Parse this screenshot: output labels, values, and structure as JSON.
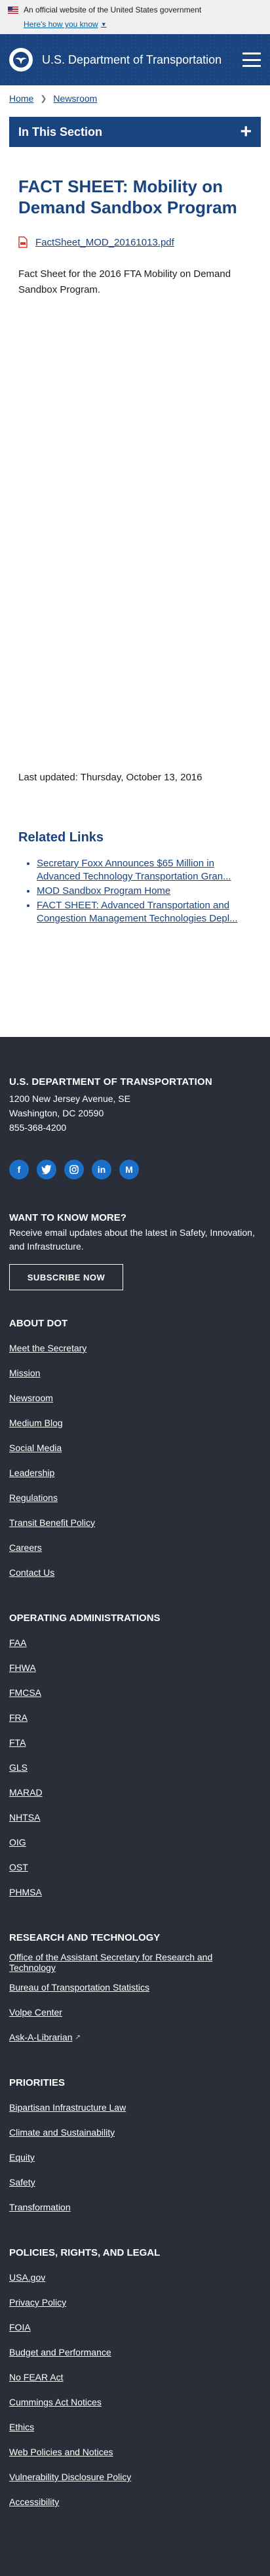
{
  "gov_banner": {
    "text": "An official website of the United States government",
    "link": "Here's how you know"
  },
  "header": {
    "title": "U.S. Department of Transportation"
  },
  "breadcrumb": [
    "Home",
    "Newsroom"
  ],
  "section_bar": {
    "label": "In This Section"
  },
  "page": {
    "title": "FACT SHEET: Mobility on Demand Sandbox Program",
    "file_name": "FactSheet_MOD_20161013.pdf",
    "body": "Fact Sheet for the 2016 FTA Mobility on Demand Sandbox Program.",
    "last_updated": "Last updated: Thursday, October 13, 2016"
  },
  "related": {
    "title": "Related Links",
    "items": [
      "Secretary Foxx Announces $65 Million in Advanced Technology Transportation Gran...",
      "MOD Sandbox Program Home",
      "FACT SHEET: Advanced Transportation and Congestion Management Technologies Depl..."
    ]
  },
  "footer": {
    "org": "U.S. DEPARTMENT OF TRANSPORTATION",
    "address": [
      "1200 New Jersey Avenue, SE",
      "Washington, DC 20590",
      "855-368-4200"
    ],
    "social": [
      "facebook-icon",
      "twitter-icon",
      "instagram-icon",
      "linkedin-icon",
      "medium-icon"
    ],
    "want_title": "WANT TO KNOW MORE?",
    "want_text": "Receive email updates about the latest in Safety, Innovation, and Infrastructure.",
    "subscribe": "SUBSCRIBE NOW",
    "about_title": "ABOUT DOT",
    "about": [
      "Meet the Secretary",
      "Mission",
      "Newsroom",
      "Medium Blog",
      "Social Media",
      "Leadership",
      "Regulations",
      "Transit Benefit Policy",
      "Careers",
      "Contact Us"
    ],
    "ops_title": "OPERATING ADMINISTRATIONS",
    "ops": [
      "FAA",
      "FHWA",
      "FMCSA",
      "FRA",
      "FTA",
      "GLS",
      "MARAD",
      "NHTSA",
      "OIG",
      "OST",
      "PHMSA"
    ],
    "research_title": "RESEARCH AND TECHNOLOGY",
    "research": [
      "Office of the Assistant Secretary for Research and Technology",
      "Bureau of Transportation Statistics",
      "Volpe Center",
      "Ask-A-Librarian"
    ],
    "priorities_title": "PRIORITIES",
    "priorities": [
      "Bipartisan Infrastructure Law",
      "Climate and Sustainability",
      "Equity",
      "Safety",
      "Transformation"
    ],
    "policies_title": "POLICIES, RIGHTS, AND LEGAL",
    "policies": [
      "USA.gov",
      "Privacy Policy",
      "FOIA",
      "Budget and Performance",
      "No FEAR Act",
      "Cummings Act Notices",
      "Ethics",
      "Web Policies and Notices",
      "Vulnerability Disclosure Policy",
      "Accessibility"
    ]
  }
}
